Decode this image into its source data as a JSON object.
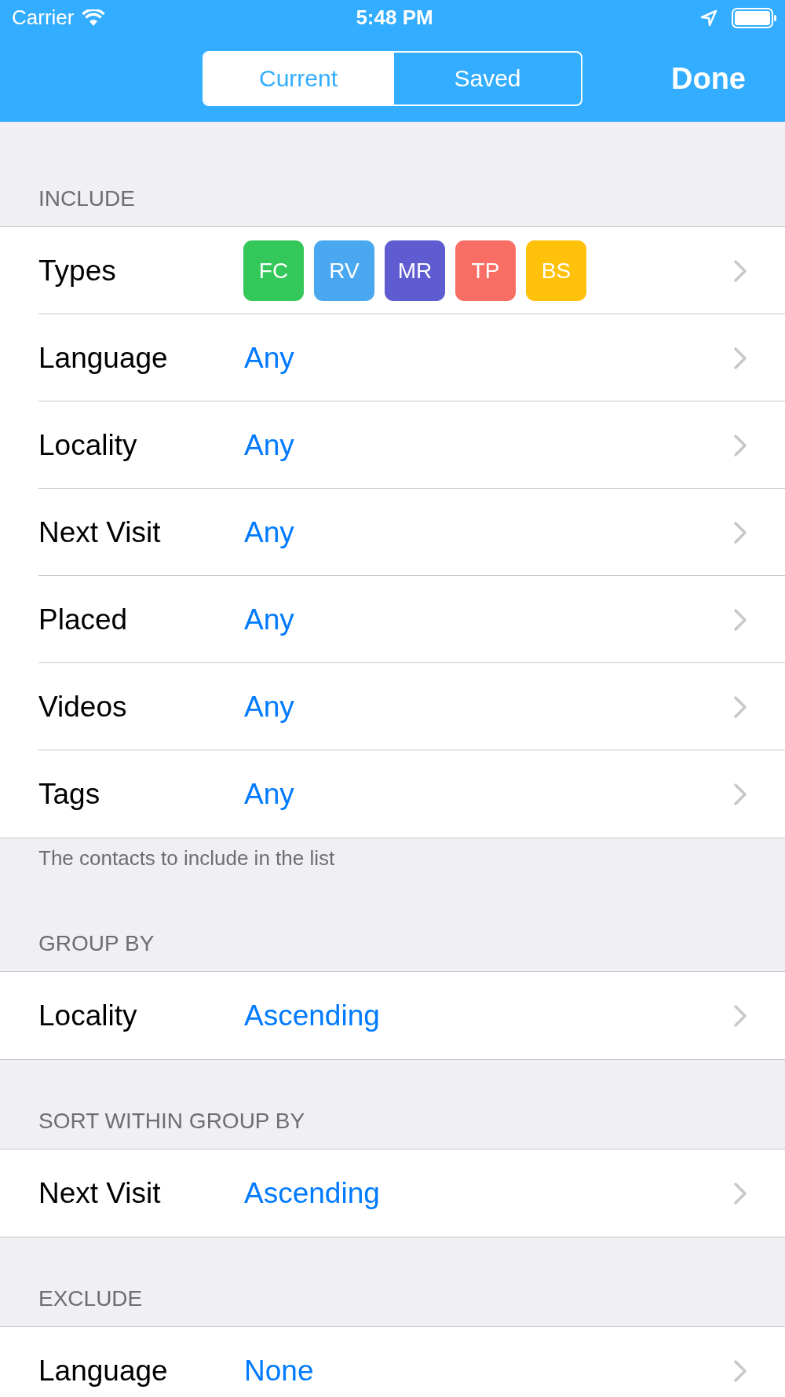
{
  "status_bar": {
    "carrier": "Carrier",
    "time": "5:48 PM"
  },
  "nav": {
    "segments": [
      {
        "label": "Current",
        "selected": true
      },
      {
        "label": "Saved",
        "selected": false
      }
    ],
    "done": "Done"
  },
  "sections": [
    {
      "header": "INCLUDE",
      "rows": [
        {
          "kind": "badges",
          "label": "Types",
          "badges": [
            {
              "label": "FC",
              "color": "#34c759"
            },
            {
              "label": "RV",
              "color": "#4aa8f0"
            },
            {
              "label": "MR",
              "color": "#5f5bd0"
            },
            {
              "label": "TP",
              "color": "#f86e65"
            },
            {
              "label": "BS",
              "color": "#ffc10a"
            }
          ]
        },
        {
          "kind": "value",
          "label": "Language",
          "value": "Any"
        },
        {
          "kind": "value",
          "label": "Locality",
          "value": "Any"
        },
        {
          "kind": "value",
          "label": "Next Visit",
          "value": "Any"
        },
        {
          "kind": "value",
          "label": "Placed",
          "value": "Any"
        },
        {
          "kind": "value",
          "label": "Videos",
          "value": "Any"
        },
        {
          "kind": "value",
          "label": "Tags",
          "value": "Any"
        }
      ],
      "footer": "The contacts to include in the list"
    },
    {
      "header": "GROUP BY",
      "rows": [
        {
          "kind": "value",
          "label": "Locality",
          "value": "Ascending"
        }
      ]
    },
    {
      "header": "SORT WITHIN GROUP BY",
      "rows": [
        {
          "kind": "value",
          "label": "Next Visit",
          "value": "Ascending"
        }
      ]
    },
    {
      "header": "EXCLUDE",
      "rows": [
        {
          "kind": "value",
          "label": "Language",
          "value": "None"
        }
      ]
    }
  ]
}
